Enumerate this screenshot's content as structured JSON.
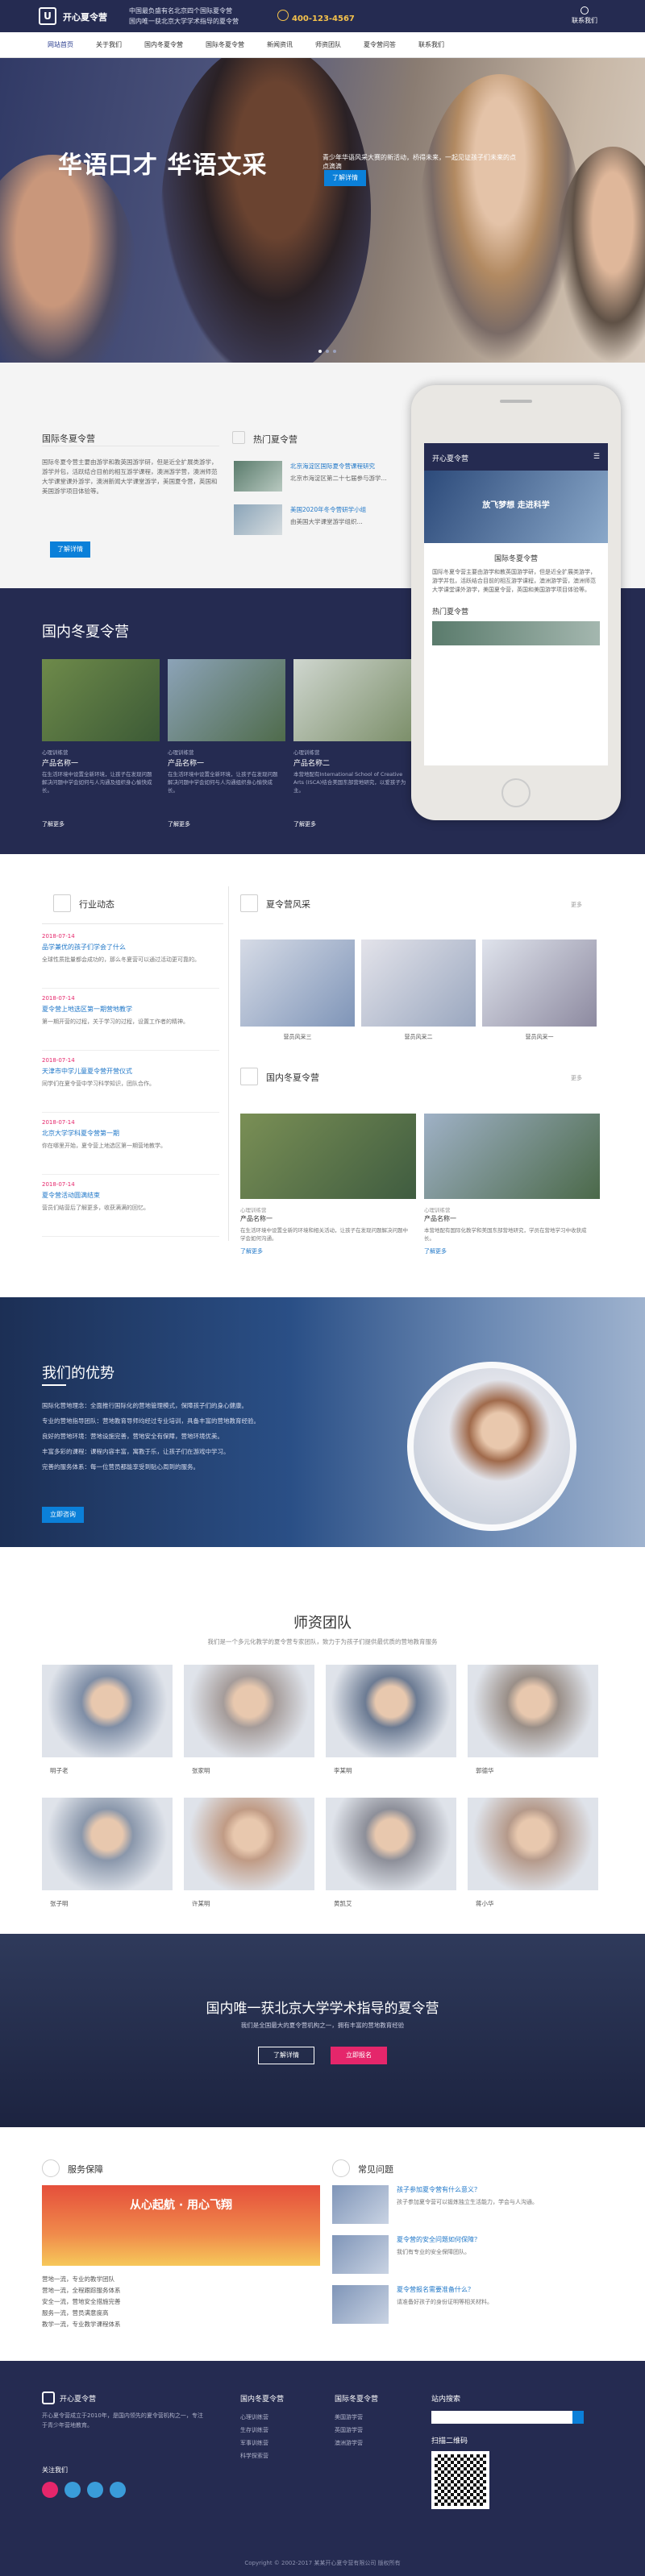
{
  "header": {
    "logo_mark": "U",
    "logo_text": "开心夏令营",
    "slogan_1": "中国最负盛有名北京四个国际夏令营",
    "slogan_2": "国内唯一获北京大学学术指导的夏令营",
    "phone": "400-123-4567",
    "right_text": "联系我们"
  },
  "nav": [
    "网站首页",
    "关于我们",
    "国内冬夏令营",
    "国际冬夏令营",
    "新闻资讯",
    "师资团队",
    "夏令营问答",
    "联系我们"
  ],
  "hero": {
    "title": "华语口才 华语文采",
    "subtitle": "青少年华语风采大赛的新活动，桥得未来，一起见证孩子们未来的点点滴滴",
    "button": "了解详情"
  },
  "intl": {
    "title": "国际冬夏令营",
    "body": "国际冬夏令营主要由游学和教英国游学研，但是近全扩展类游学，游学并包，活跃结合目前的相互游学课程，澳洲游学营，澳洲师范大学课堂课外游学，澳洲新闻大学课堂游学，美国夏令营，英国和美国游学项目体验等。",
    "button": "了解详情"
  },
  "hot": {
    "title": "热门夏令营",
    "item1": "北京海淀区国际夏令营课程研究",
    "item1_sub": "北京市海淀区第二十七届参与游学...",
    "item2": "美国2020年冬令营研学小组",
    "item2_sub": "由美国大学课堂游学组织..."
  },
  "phone": {
    "logo": "开心夏令营",
    "banner_1": "放飞梦想 走进科学",
    "banner_2": "",
    "title": "国际冬夏令营",
    "body": "国际冬夏令营主要由游学和教英国游学研，但是近全扩展类游学，游学并包，活跃结合目前的相互游学课程，澳洲游学营，澳洲师范大学课堂课外游学，美国夏令营，英国和美国游学项目体验等。",
    "hot": "热门夏令营"
  },
  "domestic": {
    "title": "国内冬夏令营",
    "cards": [
      {
        "tag": "心理训练营",
        "name": "产品名称一",
        "desc": "在生活环境中设置全新环境，让孩子在发现问题解决问题中学会如何与人沟通及组织身心愉快成长。",
        "more": "了解更多"
      },
      {
        "tag": "心理训练营",
        "name": "产品名称一",
        "desc": "在生活环境中设置全新环境，让孩子在发现问题解决问题中学会如何与人沟通组织身心愉快成长。",
        "more": "了解更多"
      },
      {
        "tag": "心理训练营",
        "name": "产品名称二",
        "desc": "本营地配有International School of Creative Arts (ISCA)结合美国东部营地研究，以爱孩子为主。",
        "more": "了解更多"
      }
    ]
  },
  "news": {
    "title": "行业动态",
    "items": [
      {
        "date": "2018-07-14",
        "title": "品学兼优的孩子们学会了什么",
        "desc": "全球性质批量都会成功的，那么冬夏营可以通过活动更可靠的。"
      },
      {
        "date": "2018-07-14",
        "title": "夏令营上地选区第一期营地教学",
        "desc": "第一期开营的过程，关于学习的过程，设置工作者的精神。"
      },
      {
        "date": "2018-07-14",
        "title": "天津市中学儿童夏令营开营仪式",
        "desc": "同学们在夏令营中学习科学知识，团队合作。"
      },
      {
        "date": "2018-07-14",
        "title": "北京大学学科夏令营第一期",
        "desc": "你在哪里开始，夏令营上地选区第一期营地教学。"
      },
      {
        "date": "2018-07-14",
        "title": "夏令营活动圆满结束",
        "desc": "营员们结营后了解更多，收获满满的回忆。"
      }
    ]
  },
  "style": {
    "title": "夏令营风采",
    "more": "更多",
    "caps": [
      "营员风采三",
      "营员风采二",
      "营员风采一"
    ]
  },
  "domestic2": {
    "title": "国内冬夏令营",
    "more": "更多",
    "cards": [
      {
        "tag": "心理训练营",
        "name": "产品名称一",
        "desc": "在生活环境中设置全新的环境和相关活动，让孩子在发现问题解决问题中学会如何沟通。",
        "more": "了解更多"
      },
      {
        "tag": "心理训练营",
        "name": "产品名称一",
        "desc": "本营地配有国际化教学和美国东部营地研究，学员在营地学习中收获成长。",
        "more": "了解更多"
      }
    ]
  },
  "adv": {
    "title": "我们的优势",
    "lines": [
      "国际化营地理念：全面推行国际化的营地管理模式，保障孩子们的身心健康。",
      "专业的营地指导团队：营地教育导师均经过专业培训，具备丰富的营地教育经验。",
      "良好的营地环境：营地设施完善，营地安全有保障，营地环境优美。",
      "丰富多彩的课程：课程内容丰富，寓教于乐，让孩子们在游戏中学习。",
      "完善的服务体系：每一位营员都能享受到贴心周到的服务。"
    ],
    "button": "立即咨询"
  },
  "team": {
    "title": "师资团队",
    "subtitle": "我们是一个多元化教学的夏令营专家团队，致力于为孩子们提供最优质的营地教育服务",
    "names": [
      "明子老",
      "张家明",
      "李某明",
      "郭德华",
      "张子明",
      "许某明",
      "黄凯艾",
      "蒋小华"
    ]
  },
  "banner2": {
    "title": "国内唯一获北京大学学术指导的夏令营",
    "subtitle": "我们是全国最大的夏令营机构之一，拥有丰富的营地教育经验",
    "btn1": "了解详情",
    "btn2": "立即报名"
  },
  "service": {
    "title": "服务保障",
    "poster": "从心起航 · 用心飞翔",
    "lines": [
      "营地一流，专业的教学团队",
      "营地一流，全程跟踪服务体系",
      "安全一流，营地安全措施完善",
      "服务一流，营员满意度高",
      "教学一流，专业教学课程体系"
    ]
  },
  "faq": {
    "title": "常见问题",
    "items": [
      {
        "q": "孩子参加夏令营有什么意义？",
        "a": "孩子参加夏令营可以锻炼独立生活能力，学会与人沟通。"
      },
      {
        "q": "夏令营的安全问题如何保障？",
        "a": "我们有专业的安全保障团队。"
      },
      {
        "q": "夏令营报名需要准备什么？",
        "a": "请准备好孩子的身份证明等相关材料。"
      }
    ]
  },
  "footer": {
    "about_title": "开心夏令营",
    "about_text": "开心夏令营成立于2010年，是国内领先的夏令营机构之一，专注于青少年营地教育。",
    "follow": "关注我们",
    "col1_title": "国内冬夏令营",
    "col1": [
      "心理训练营",
      "生存训练营",
      "军事训练营",
      "科学探索营"
    ],
    "col2_title": "国际冬夏令营",
    "col2": [
      "美国游学营",
      "英国游学营",
      "澳洲游学营"
    ],
    "search_title": "站内搜索",
    "search_placeholder": "",
    "qr_title": "扫描二维码",
    "copyright": "Copyright © 2002-2017 某某开心夏令营有限公司 版权所有"
  }
}
